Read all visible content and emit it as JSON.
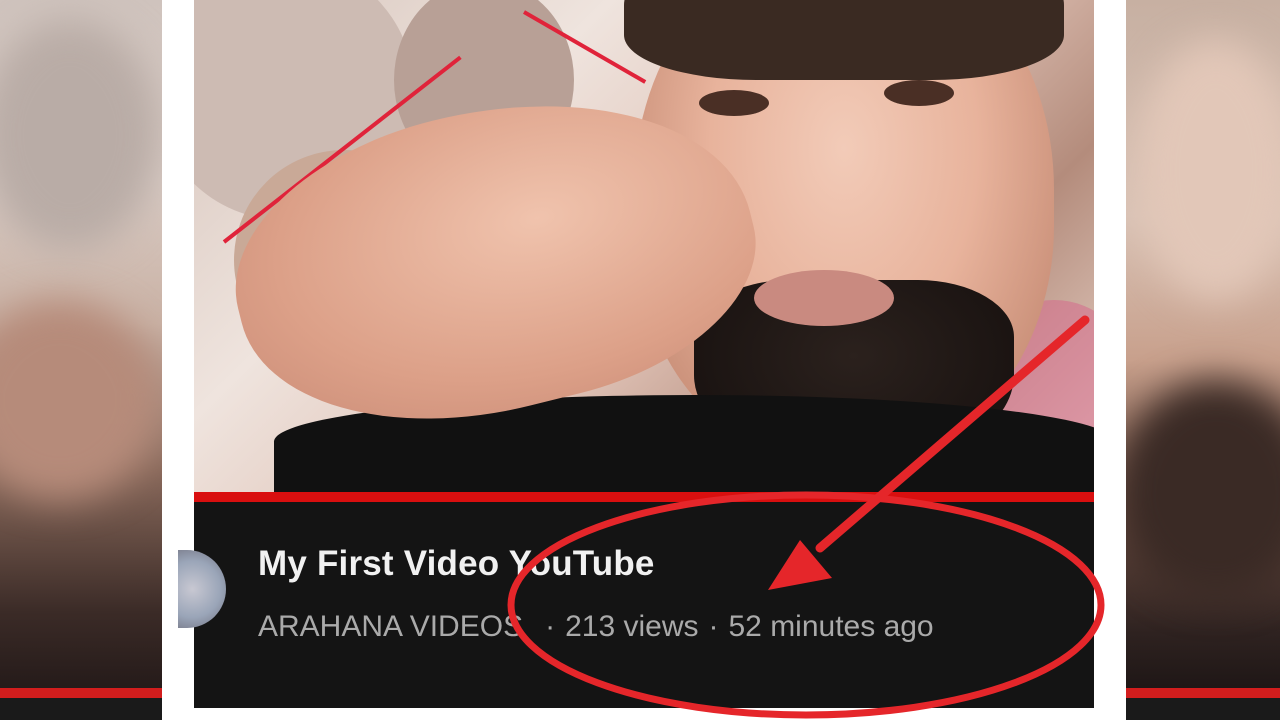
{
  "video": {
    "title": "My First Video YouTube",
    "channel": "ARAHANA VIDEOS",
    "separator": "·",
    "views": "213 views",
    "age": "52 minutes ago"
  },
  "colors": {
    "progress": "#d90f0f",
    "info_bar_bg": "#141414",
    "title_text": "#f1f1f1",
    "meta_text": "#aaaaaa",
    "annotation_red": "#e5262a"
  },
  "icons": {
    "avatar": "channel-avatar",
    "arrow": "annotation-arrow",
    "circle": "annotation-ellipse"
  }
}
